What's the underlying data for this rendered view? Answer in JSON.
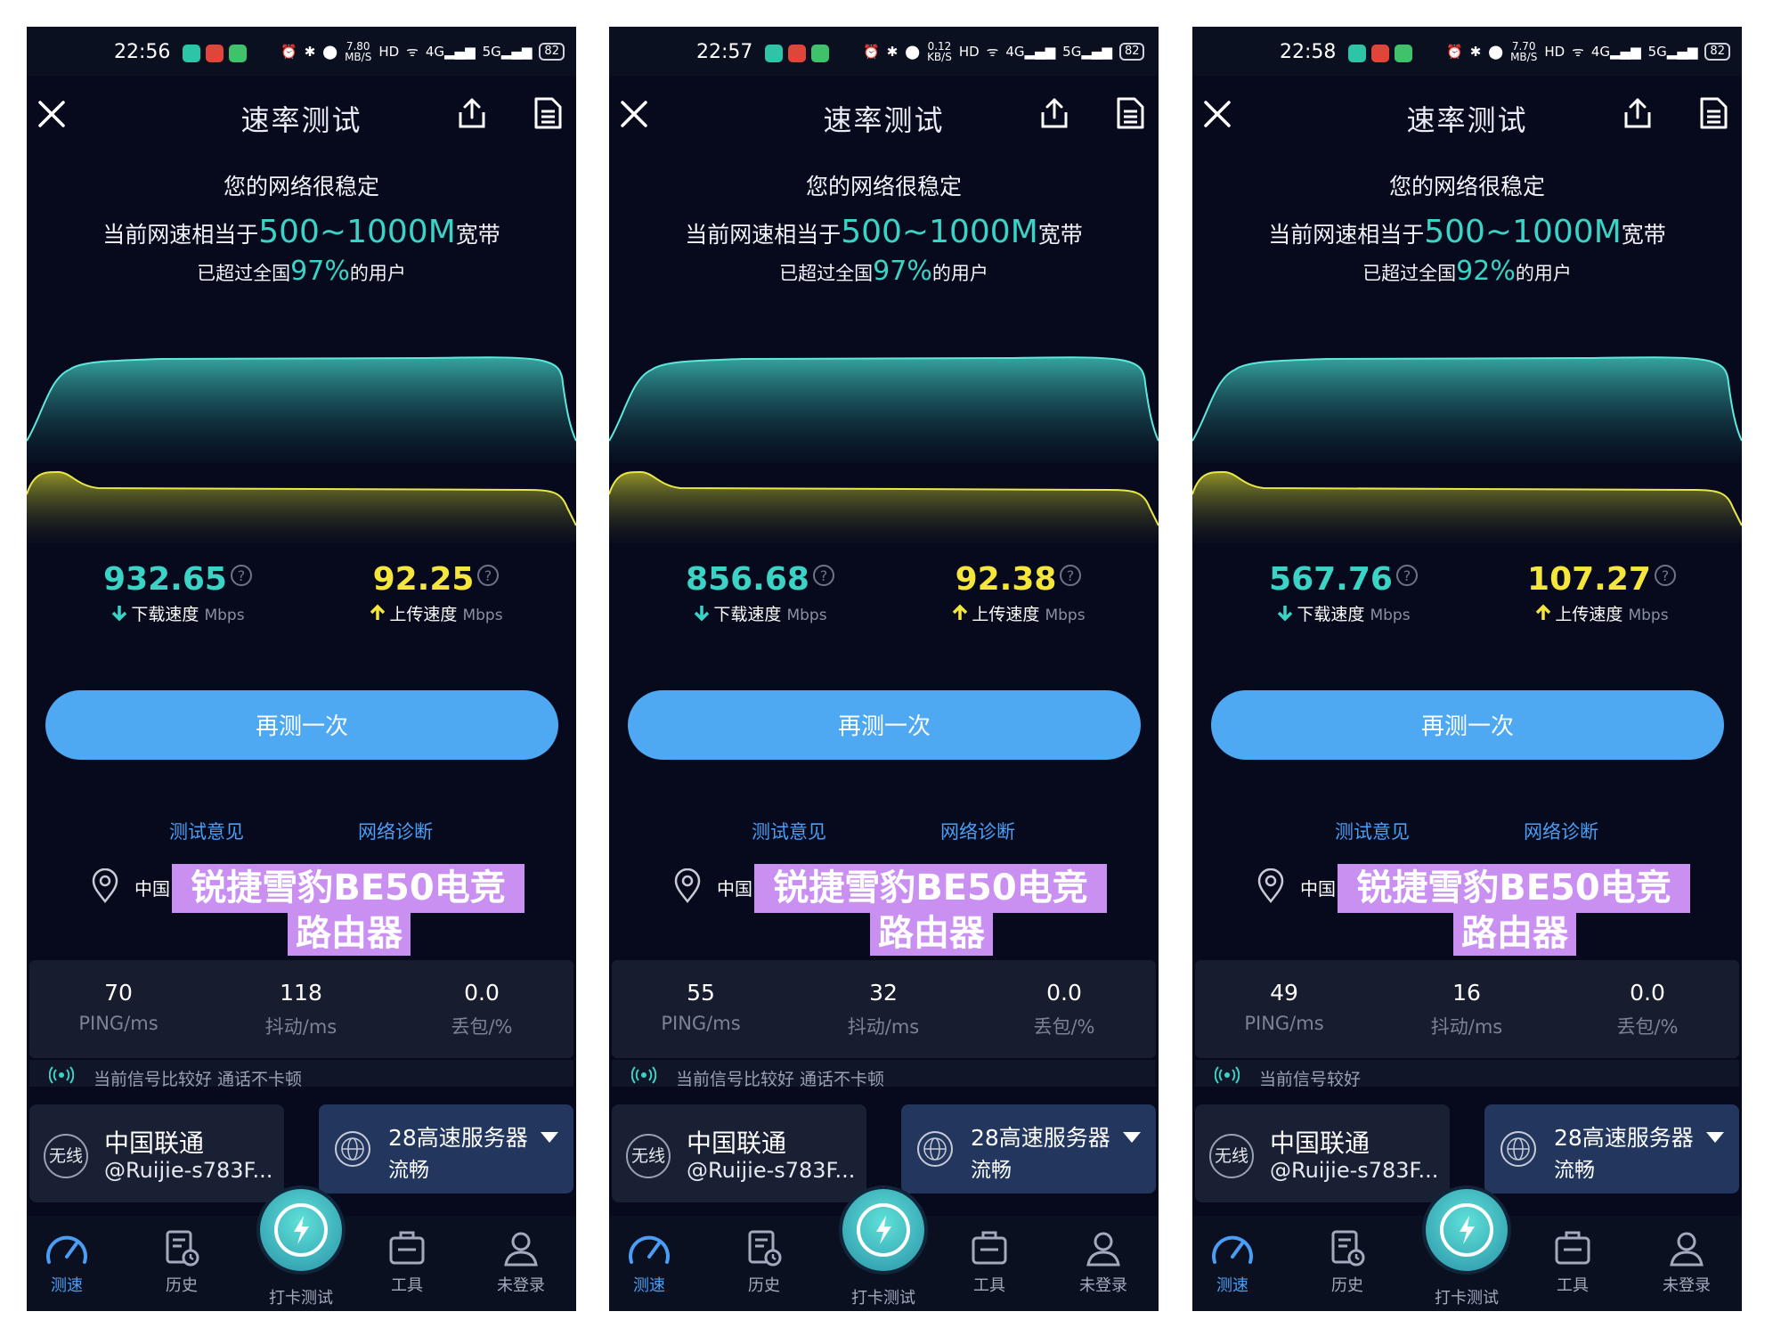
{
  "colors": {
    "teal": "#3ad3c5",
    "yellow": "#f5e63b",
    "link_blue": "#4b9ef5",
    "button_blue": "#4ea8f2",
    "banner_purple": "#c98ff1",
    "background": "#060a1c"
  },
  "screens": [
    {
      "status": {
        "time": "22:56",
        "net_speed": "7.80",
        "net_unit": "MB/S",
        "battery": "82"
      },
      "header": {
        "title": "速率测试"
      },
      "summary": {
        "stable": "您的网络很稳定",
        "eq_prefix": "当前网速相当于",
        "eq_range": "500~1000M",
        "eq_suffix": "宽带",
        "pct_prefix": "已超过全国",
        "pct": "97%",
        "pct_suffix": "的用户"
      },
      "download": {
        "value": "932.65",
        "label": "下载速度",
        "unit": "Mbps"
      },
      "upload": {
        "value": "92.25",
        "label": "上传速度",
        "unit": "Mbps"
      },
      "retest_label": "再测一次",
      "links": {
        "feedback": "测试意见",
        "diagnose": "网络诊断"
      },
      "location": {
        "country": "中国",
        "banner_line1": "锐捷雪豹BE50电竞",
        "banner_line2": "路由器"
      },
      "metrics": {
        "ping": "70",
        "ping_label": "PING/ms",
        "jitter": "118",
        "jitter_label": "抖动/ms",
        "loss": "0.0",
        "loss_label": "丢包/%"
      },
      "signal_text": "当前信号比较好 通话不卡顿",
      "carrier": {
        "badge": "无线",
        "name": "中国联通",
        "ssid": "@Ruijie-s783F..."
      },
      "server": {
        "name": "28高速服务器",
        "status": "流畅"
      },
      "tabs": {
        "speed": "测速",
        "history": "历史",
        "checkin": "打卡测试",
        "tools": "工具",
        "login": "未登录"
      }
    },
    {
      "status": {
        "time": "22:57",
        "net_speed": "0.12",
        "net_unit": "KB/S",
        "battery": "82"
      },
      "header": {
        "title": "速率测试"
      },
      "summary": {
        "stable": "您的网络很稳定",
        "eq_prefix": "当前网速相当于",
        "eq_range": "500~1000M",
        "eq_suffix": "宽带",
        "pct_prefix": "已超过全国",
        "pct": "97%",
        "pct_suffix": "的用户"
      },
      "download": {
        "value": "856.68",
        "label": "下载速度",
        "unit": "Mbps"
      },
      "upload": {
        "value": "92.38",
        "label": "上传速度",
        "unit": "Mbps"
      },
      "retest_label": "再测一次",
      "links": {
        "feedback": "测试意见",
        "diagnose": "网络诊断"
      },
      "location": {
        "country": "中国",
        "banner_line1": "锐捷雪豹BE50电竞",
        "banner_line2": "路由器"
      },
      "metrics": {
        "ping": "55",
        "ping_label": "PING/ms",
        "jitter": "32",
        "jitter_label": "抖动/ms",
        "loss": "0.0",
        "loss_label": "丢包/%"
      },
      "signal_text": "当前信号比较好 通话不卡顿",
      "carrier": {
        "badge": "无线",
        "name": "中国联通",
        "ssid": "@Ruijie-s783F..."
      },
      "server": {
        "name": "28高速服务器",
        "status": "流畅"
      },
      "tabs": {
        "speed": "测速",
        "history": "历史",
        "checkin": "打卡测试",
        "tools": "工具",
        "login": "未登录"
      }
    },
    {
      "status": {
        "time": "22:58",
        "net_speed": "7.70",
        "net_unit": "MB/S",
        "battery": "82"
      },
      "header": {
        "title": "速率测试"
      },
      "summary": {
        "stable": "您的网络很稳定",
        "eq_prefix": "当前网速相当于",
        "eq_range": "500~1000M",
        "eq_suffix": "宽带",
        "pct_prefix": "已超过全国",
        "pct": "92%",
        "pct_suffix": "的用户"
      },
      "download": {
        "value": "567.76",
        "label": "下载速度",
        "unit": "Mbps"
      },
      "upload": {
        "value": "107.27",
        "label": "上传速度",
        "unit": "Mbps"
      },
      "retest_label": "再测一次",
      "links": {
        "feedback": "测试意见",
        "diagnose": "网络诊断"
      },
      "location": {
        "country": "中国",
        "banner_line1": "锐捷雪豹BE50电竞",
        "banner_line2": "路由器"
      },
      "metrics": {
        "ping": "49",
        "ping_label": "PING/ms",
        "jitter": "16",
        "jitter_label": "抖动/ms",
        "loss": "0.0",
        "loss_label": "丢包/%"
      },
      "signal_text": "当前信号较好",
      "carrier": {
        "badge": "无线",
        "name": "中国联通",
        "ssid": "@Ruijie-s783F..."
      },
      "server": {
        "name": "28高速服务器",
        "status": "流畅"
      },
      "tabs": {
        "speed": "测速",
        "history": "历史",
        "checkin": "打卡测试",
        "tools": "工具",
        "login": "未登录"
      }
    }
  ]
}
